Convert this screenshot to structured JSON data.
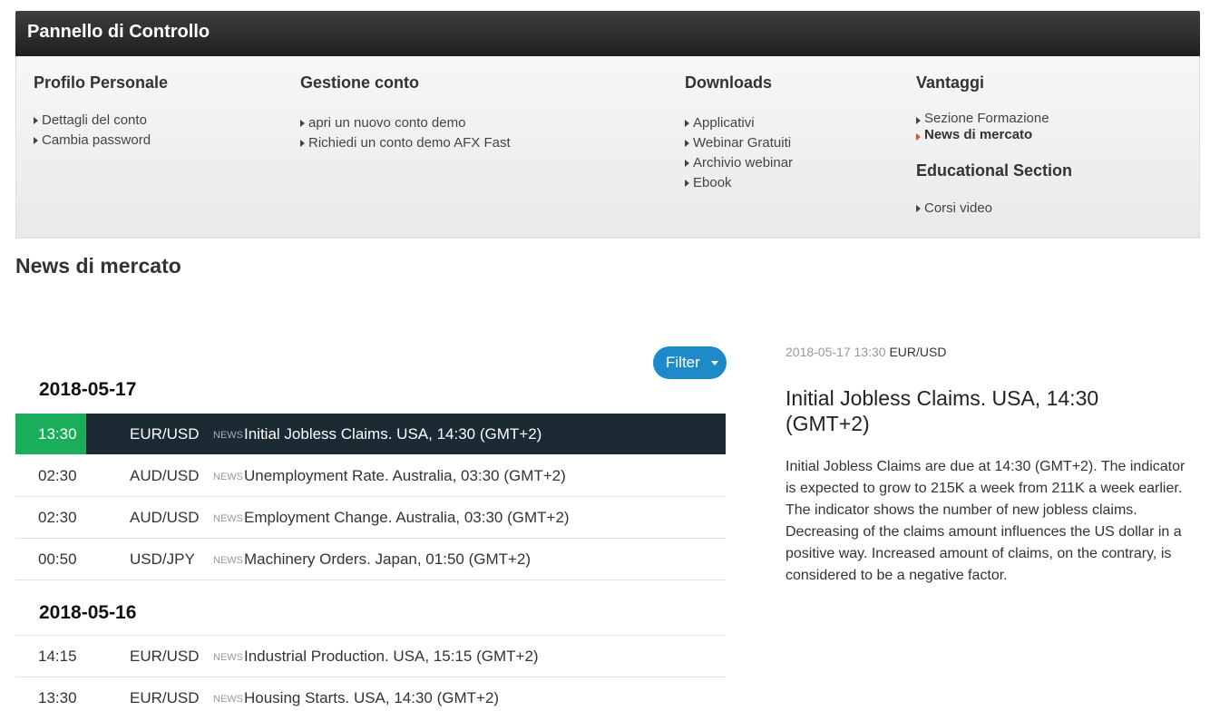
{
  "panel": {
    "title": "Pannello di Controllo",
    "columns": [
      {
        "heading": "Profilo Personale",
        "items": [
          "Dettagli del conto",
          "Cambia password"
        ]
      },
      {
        "heading": "Gestione conto",
        "items": [
          "apri un nuovo conto demo",
          "Richiedi un conto demo AFX Fast"
        ]
      },
      {
        "heading": "Downloads",
        "items": [
          "Applicativi",
          "Webinar Gratuiti",
          "Archivio webinar",
          "Ebook"
        ]
      },
      {
        "heading": "Vantaggi",
        "items": [
          "Sezione Formazione",
          "News di mercato"
        ],
        "heading2": "Educational Section",
        "items2": [
          "Corsi video"
        ]
      }
    ]
  },
  "page_title": "News di mercato",
  "filter_label": "Filter",
  "news_label": "NEWS",
  "groups": [
    {
      "date": "2018-05-17",
      "rows": [
        {
          "time": "13:30",
          "pair": "EUR/USD",
          "title": "Initial Jobless Claims. USA, 14:30 (GMT+2)"
        },
        {
          "time": "02:30",
          "pair": "AUD/USD",
          "title": "Unemployment Rate. Australia, 03:30 (GMT+2)"
        },
        {
          "time": "02:30",
          "pair": "AUD/USD",
          "title": "Employment Change. Australia, 03:30 (GMT+2)"
        },
        {
          "time": "00:50",
          "pair": "USD/JPY",
          "title": "Machinery Orders. Japan, 01:50 (GMT+2)"
        }
      ]
    },
    {
      "date": "2018-05-16",
      "rows": [
        {
          "time": "14:15",
          "pair": "EUR/USD",
          "title": "Industrial Production. USA, 15:15 (GMT+2)"
        },
        {
          "time": "13:30",
          "pair": "EUR/USD",
          "title": "Housing Starts. USA, 14:30 (GMT+2)"
        }
      ]
    }
  ],
  "detail": {
    "datetime": "2018-05-17 13:30",
    "pair": "EUR/USD",
    "title": "Initial Jobless Claims. USA, 14:30 (GMT+2)",
    "text": "Initial Jobless Claims are due at 14:30 (GMT+2). The indicator is expected to grow to 215K a week from 211K a week earlier. The indicator shows the number of new jobless claims. Decreasing of the claims amount influences the US dollar in a positive way. Increased amount of claims, on the contrary, is considered to be a negative factor."
  }
}
